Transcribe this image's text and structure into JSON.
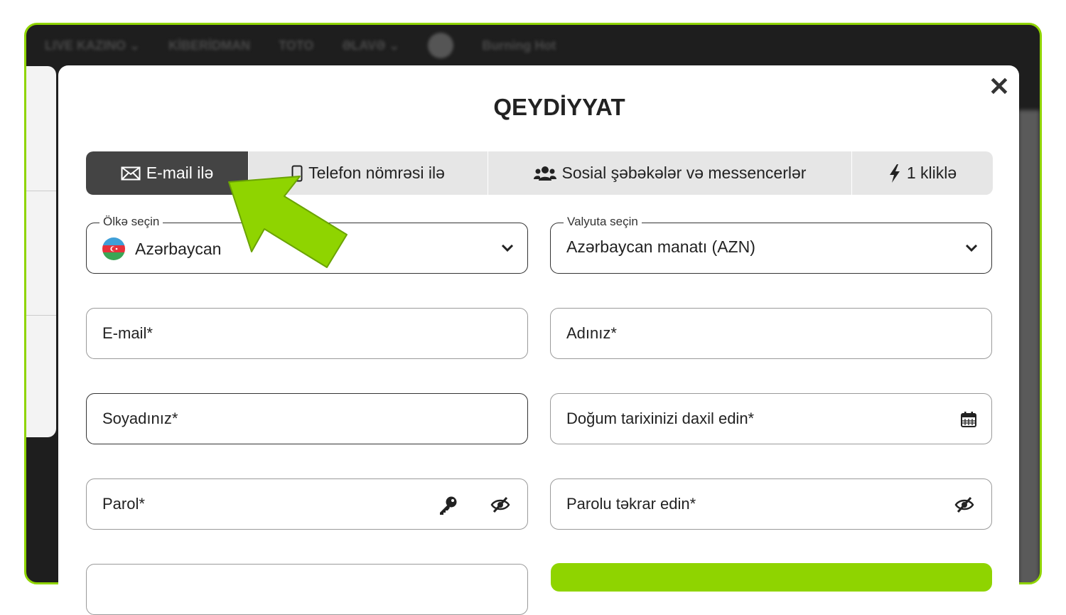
{
  "nav": {
    "items": [
      "LIVE KAZINO ⌄",
      "KİBERİDMAN",
      "TOTO",
      "ƏLAVƏ ⌄",
      "Burning Hot"
    ]
  },
  "modal": {
    "title": "QEYDİYYAT",
    "close_symbol": "✕",
    "tabs": [
      {
        "label": "E-mail ilə",
        "icon": "envelope-icon",
        "active": true
      },
      {
        "label": "Telefon nömrəsi ilə",
        "icon": "phone-icon",
        "active": false
      },
      {
        "label": "Sosial şəbəkələr və messencerlər",
        "icon": "users-icon",
        "active": false
      },
      {
        "label": "1 kliklə",
        "icon": "lightning-icon",
        "active": false
      }
    ],
    "country": {
      "legend": "Ölkə seçin",
      "value": "Azərbaycan",
      "icon": "azerbaijan-flag-icon"
    },
    "currency": {
      "legend": "Valyuta seçin",
      "value": "Azərbaycan manatı (AZN)"
    },
    "fields": {
      "email": "E-mail*",
      "first_name": "Adınız*",
      "last_name": "Soyadınız*",
      "birth_date": "Doğum tarixinizi daxil edin*",
      "password": "Parol*",
      "password_repeat": "Parolu təkrar edin*"
    }
  },
  "colors": {
    "accent": "#8fd400",
    "active_tab": "#444444",
    "tab_bg": "#e6e6e6"
  }
}
